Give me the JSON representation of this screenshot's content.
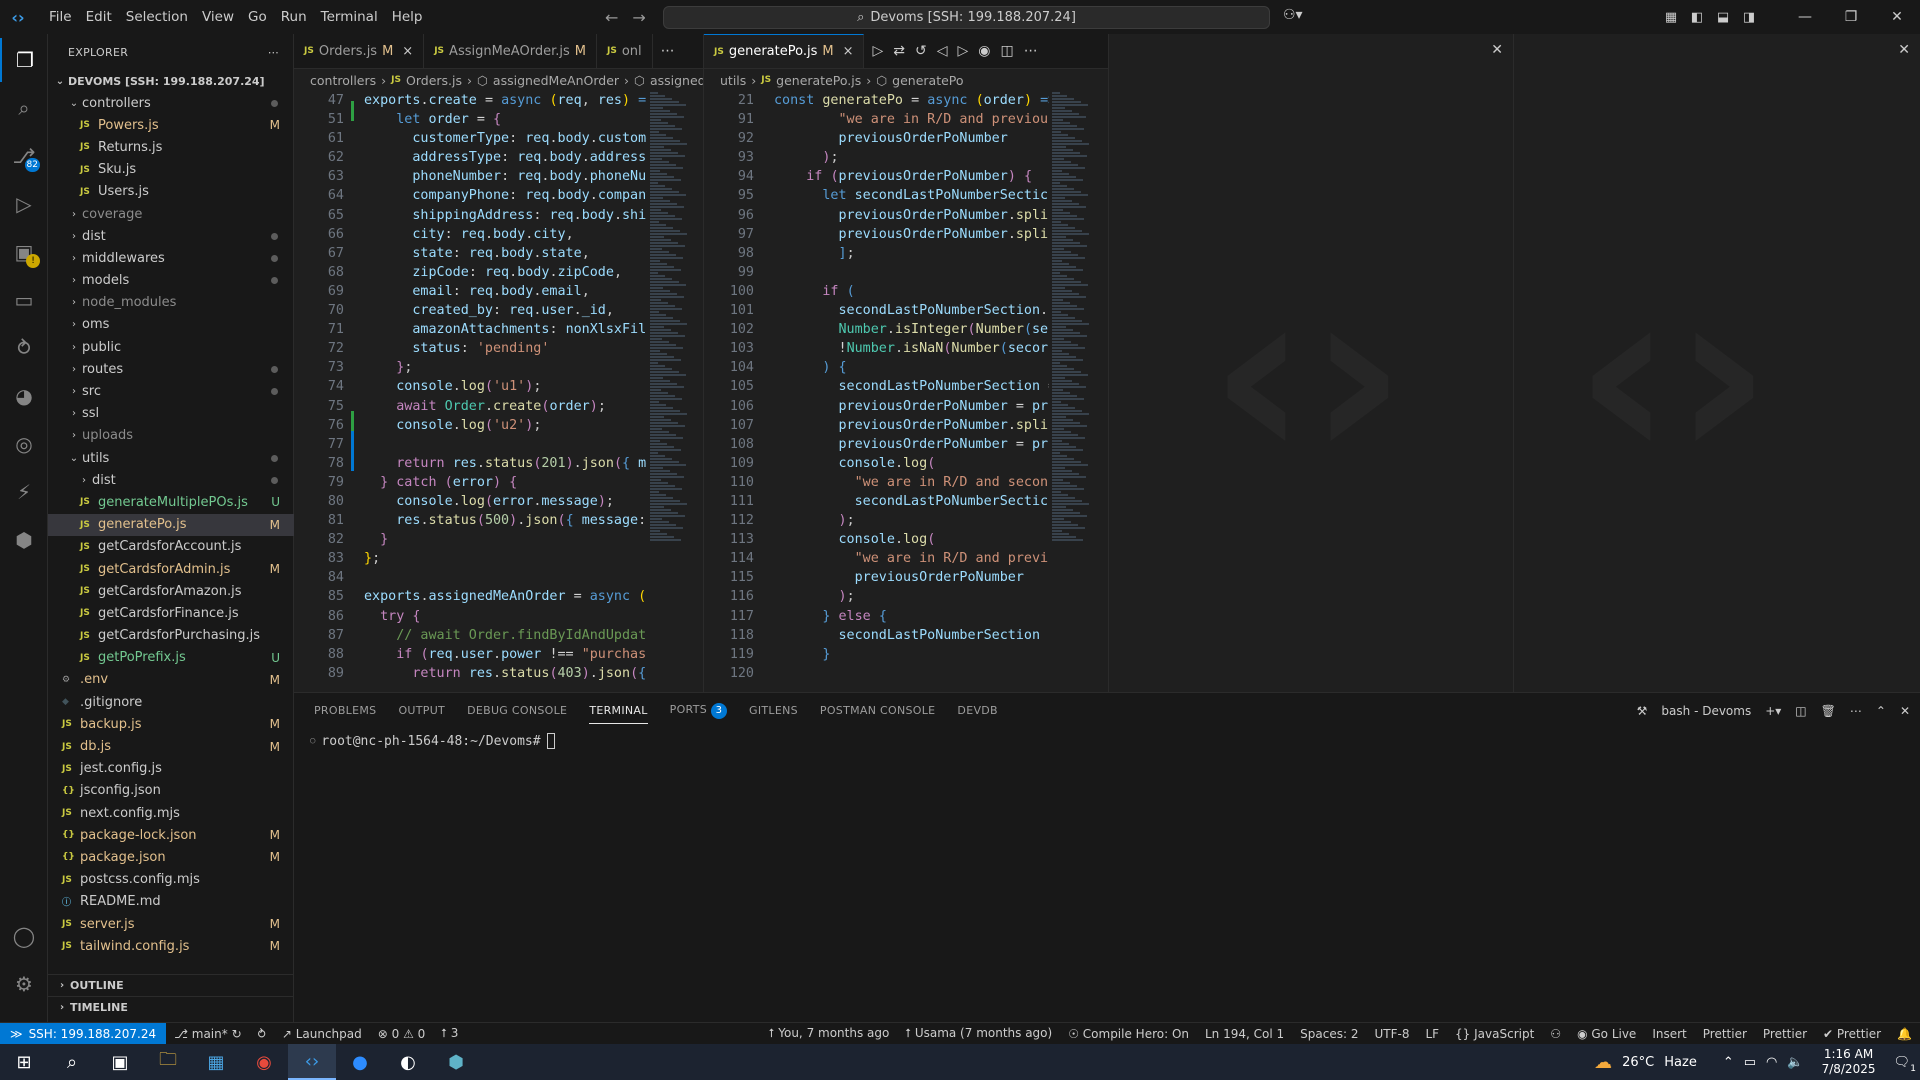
{
  "titlebar": {
    "menu": [
      "File",
      "Edit",
      "Selection",
      "View",
      "Go",
      "Run",
      "Terminal",
      "Help"
    ],
    "command_center": "Devoms [SSH: 199.188.207.24]"
  },
  "explorer": {
    "title": "EXPLORER",
    "root": "DEVOMS [SSH: 199.188.207.24]",
    "rows": [
      {
        "name": "controllers",
        "type": "folder-open",
        "indent": 1,
        "badge": "dot"
      },
      {
        "name": "Powers.js",
        "type": "js",
        "indent": 2,
        "badge": "M",
        "status": "mod"
      },
      {
        "name": "Returns.js",
        "type": "js",
        "indent": 2,
        "badge": "",
        "status": ""
      },
      {
        "name": "Sku.js",
        "type": "js",
        "indent": 2,
        "badge": "",
        "status": ""
      },
      {
        "name": "Users.js",
        "type": "js",
        "indent": 2,
        "badge": "",
        "status": ""
      },
      {
        "name": "coverage",
        "type": "folder",
        "indent": 1,
        "badge": "",
        "status": "dim"
      },
      {
        "name": "dist",
        "type": "folder",
        "indent": 1,
        "badge": "dot",
        "status": ""
      },
      {
        "name": "middlewares",
        "type": "folder",
        "indent": 1,
        "badge": "dot",
        "status": ""
      },
      {
        "name": "models",
        "type": "folder",
        "indent": 1,
        "badge": "dot",
        "status": ""
      },
      {
        "name": "node_modules",
        "type": "folder",
        "indent": 1,
        "badge": "",
        "status": "dim"
      },
      {
        "name": "oms",
        "type": "folder",
        "indent": 1,
        "badge": "",
        "status": ""
      },
      {
        "name": "public",
        "type": "folder",
        "indent": 1,
        "badge": "",
        "status": ""
      },
      {
        "name": "routes",
        "type": "folder",
        "indent": 1,
        "badge": "dot",
        "status": ""
      },
      {
        "name": "src",
        "type": "folder",
        "indent": 1,
        "badge": "dot",
        "status": ""
      },
      {
        "name": "ssl",
        "type": "folder",
        "indent": 1,
        "badge": "",
        "status": ""
      },
      {
        "name": "uploads",
        "type": "folder",
        "indent": 1,
        "badge": "",
        "status": "dim"
      },
      {
        "name": "utils",
        "type": "folder-open",
        "indent": 1,
        "badge": "dot",
        "status": ""
      },
      {
        "name": "dist",
        "type": "folder",
        "indent": 2,
        "badge": "dot",
        "status": ""
      },
      {
        "name": "generateMultiplePOs.js",
        "type": "js",
        "indent": 2,
        "badge": "U",
        "status": "new"
      },
      {
        "name": "generatePo.js",
        "type": "js",
        "indent": 2,
        "badge": "M",
        "status": "mod",
        "selected": true
      },
      {
        "name": "getCardsforAccount.js",
        "type": "js",
        "indent": 2,
        "badge": "",
        "status": ""
      },
      {
        "name": "getCardsforAdmin.js",
        "type": "js",
        "indent": 2,
        "badge": "M",
        "status": "mod"
      },
      {
        "name": "getCardsforAmazon.js",
        "type": "js",
        "indent": 2,
        "badge": "",
        "status": ""
      },
      {
        "name": "getCardsforFinance.js",
        "type": "js",
        "indent": 2,
        "badge": "",
        "status": ""
      },
      {
        "name": "getCardsforPurchasing.js",
        "type": "js",
        "indent": 2,
        "badge": "",
        "status": ""
      },
      {
        "name": "getPoPrefix.js",
        "type": "js",
        "indent": 2,
        "badge": "U",
        "status": "new"
      },
      {
        "name": ".env",
        "type": "gear",
        "indent": 0,
        "badge": "M",
        "status": "mod"
      },
      {
        "name": ".gitignore",
        "type": "git",
        "indent": 0,
        "badge": "",
        "status": ""
      },
      {
        "name": "backup.js",
        "type": "js",
        "indent": 0,
        "badge": "M",
        "status": "mod"
      },
      {
        "name": "db.js",
        "type": "js",
        "indent": 0,
        "badge": "M",
        "status": "mod"
      },
      {
        "name": "jest.config.js",
        "type": "js",
        "indent": 0,
        "badge": "",
        "status": ""
      },
      {
        "name": "jsconfig.json",
        "type": "json",
        "indent": 0,
        "badge": "",
        "status": ""
      },
      {
        "name": "next.config.mjs",
        "type": "js",
        "indent": 0,
        "badge": "",
        "status": ""
      },
      {
        "name": "package-lock.json",
        "type": "json",
        "indent": 0,
        "badge": "M",
        "status": "mod"
      },
      {
        "name": "package.json",
        "type": "json",
        "indent": 0,
        "badge": "M",
        "status": "mod"
      },
      {
        "name": "postcss.config.mjs",
        "type": "js",
        "indent": 0,
        "badge": "",
        "status": ""
      },
      {
        "name": "README.md",
        "type": "info",
        "indent": 0,
        "badge": "",
        "status": ""
      },
      {
        "name": "server.js",
        "type": "js",
        "indent": 0,
        "badge": "M",
        "status": "mod"
      },
      {
        "name": "tailwind.config.js",
        "type": "js",
        "indent": 0,
        "badge": "M",
        "status": "mod"
      }
    ],
    "outline": "OUTLINE",
    "timeline": "TIMELINE"
  },
  "editor_left": {
    "tabs": [
      {
        "label": "Orders.js",
        "mod": "M",
        "close": "×"
      },
      {
        "label": "AssignMeAOrder.js",
        "mod": "M",
        "close": ""
      },
      {
        "label": "onl",
        "mod": "",
        "close": ""
      }
    ],
    "breadcrumbs": [
      "controllers",
      "Orders.js",
      "assignedMeAnOrder",
      "assigned"
    ],
    "lines": [
      {
        "n": "47",
        "h": "<span class='v'>exports</span><span class='p'>.</span><span class='v'>create</span> <span class='p'>=</span> <span class='k'>async</span> <span class='y'>(</span><span class='v'>req</span>, <span class='v'>res</span><span class='y'>)</span> <span class='k'>=</span>"
      },
      {
        "n": "51",
        "h": "    <span class='k'>let</span> <span class='v'>order</span> <span class='p'>=</span> <span class='kc'>{</span>"
      },
      {
        "n": "61",
        "h": "      <span class='v'>customerType</span>: <span class='v'>req</span>.<span class='v'>body</span>.<span class='v'>custome</span>"
      },
      {
        "n": "62",
        "h": "      <span class='v'>addressType</span>: <span class='v'>req</span>.<span class='v'>body</span>.<span class='v'>address</span>"
      },
      {
        "n": "63",
        "h": "      <span class='v'>phoneNumber</span>: <span class='v'>req</span>.<span class='v'>body</span>.<span class='v'>phoneNu</span>"
      },
      {
        "n": "64",
        "h": "      <span class='v'>companyPhone</span>: <span class='v'>req</span>.<span class='v'>body</span>.<span class='v'>company</span>"
      },
      {
        "n": "65",
        "h": "      <span class='v'>shippingAddress</span>: <span class='v'>req</span>.<span class='v'>body</span>.<span class='v'>shi</span>"
      },
      {
        "n": "66",
        "h": "      <span class='v'>city</span>: <span class='v'>req</span>.<span class='v'>body</span>.<span class='v'>city</span>,"
      },
      {
        "n": "67",
        "h": "      <span class='v'>state</span>: <span class='v'>req</span>.<span class='v'>body</span>.<span class='v'>state</span>,"
      },
      {
        "n": "68",
        "h": "      <span class='v'>zipCode</span>: <span class='v'>req</span>.<span class='v'>body</span>.<span class='v'>zipCode</span>,"
      },
      {
        "n": "69",
        "h": "      <span class='v'>email</span>: <span class='v'>req</span>.<span class='v'>body</span>.<span class='v'>email</span>,"
      },
      {
        "n": "70",
        "h": "      <span class='v'>created_by</span>: <span class='v'>req</span>.<span class='v'>user</span>.<span class='v'>_id</span>,"
      },
      {
        "n": "71",
        "h": "      <span class='v'>amazonAttachments</span>: <span class='v'>nonXlsxFil</span>"
      },
      {
        "n": "72",
        "h": "      <span class='v'>status</span>: <span class='s'>'pending'</span>"
      },
      {
        "n": "73",
        "h": "    <span class='kc'>}</span>;"
      },
      {
        "n": "74",
        "h": "    <span class='v'>console</span>.<span class='f'>log</span><span class='kc'>(</span><span class='s'>'u1'</span><span class='kc'>)</span>;"
      },
      {
        "n": "75",
        "h": "    <span class='kc'>await</span> <span class='t'>Order</span>.<span class='f'>create</span><span class='kc'>(</span><span class='v'>order</span><span class='kc'>)</span>;"
      },
      {
        "n": "76",
        "h": "    <span class='v'>console</span>.<span class='f'>log</span><span class='kc'>(</span><span class='s'>'u2'</span><span class='kc'>)</span>;"
      },
      {
        "n": "77",
        "h": ""
      },
      {
        "n": "78",
        "h": "    <span class='kc'>return</span> <span class='v'>res</span>.<span class='f'>status</span><span class='kc'>(</span><span class='n'>201</span><span class='kc'>)</span>.<span class='f'>json</span><span class='kc'>(</span><span class='k'>{</span> <span class='v'>me</span>"
      },
      {
        "n": "79",
        "h": "  <span class='kc'>}</span> <span class='kc'>catch</span> <span class='kc'>(</span><span class='v'>error</span><span class='kc'>)</span> <span class='kc'>{</span>"
      },
      {
        "n": "80",
        "h": "    <span class='v'>console</span>.<span class='f'>log</span><span class='kc'>(</span><span class='v'>error</span>.<span class='v'>message</span><span class='kc'>)</span>;"
      },
      {
        "n": "81",
        "h": "    <span class='v'>res</span>.<span class='f'>status</span><span class='kc'>(</span><span class='n'>500</span><span class='kc'>)</span>.<span class='f'>json</span><span class='kc'>(</span><span class='k'>{</span> <span class='v'>message</span>:"
      },
      {
        "n": "82",
        "h": "  <span class='kc'>}</span>"
      },
      {
        "n": "83",
        "h": "<span class='y'>}</span>;"
      },
      {
        "n": "84",
        "h": ""
      },
      {
        "n": "85",
        "h": "<span class='v'>exports</span>.<span class='v'>assignedMeAnOrder</span> <span class='p'>=</span> <span class='k'>async</span> <span class='y'>(</span>"
      },
      {
        "n": "86",
        "h": "  <span class='kc'>try</span> <span class='kc'>{</span>"
      },
      {
        "n": "87",
        "h": "    <span class='c'>// await Order.findByIdAndUpdate</span>"
      },
      {
        "n": "88",
        "h": "    <span class='kc'>if</span> <span class='kc'>(</span><span class='v'>req</span>.<span class='v'>user</span>.<span class='v'>power</span> <span class='p'>!==</span> <span class='s'>\"purchas</span>"
      },
      {
        "n": "89",
        "h": "      <span class='kc'>return</span> <span class='v'>res</span>.<span class='f'>status</span><span class='kc'>(</span><span class='n'>403</span><span class='kc'>)</span>.<span class='f'>json</span><span class='kc'>(</span><span class='k'>{</span>"
      }
    ]
  },
  "editor_right": {
    "tabs": [
      {
        "label": "generatePo.js",
        "mod": "M",
        "close": "×"
      }
    ],
    "breadcrumbs": [
      "utils",
      "generatePo.js",
      "generatePo"
    ],
    "lines": [
      {
        "n": "21",
        "h": "<span class='k'>const</span> <span class='f'>generatePo</span> <span class='p'>=</span> <span class='k'>async</span> <span class='y'>(</span><span class='v'>order</span><span class='y'>)</span> <span class='k'>=></span>"
      },
      {
        "n": "91",
        "h": "        <span class='s'>\"we are in R/D and previous</span>"
      },
      {
        "n": "92",
        "h": "        <span class='v'>previousOrderPoNumber</span>"
      },
      {
        "n": "93",
        "h": "      <span class='kc'>)</span>;"
      },
      {
        "n": "94",
        "h": "    <span class='kc'>if</span> <span class='kc'>(</span><span class='v'>previousOrderPoNumber</span><span class='kc'>)</span> <span class='kc'>{</span>"
      },
      {
        "n": "95",
        "h": "      <span class='k'>let</span> <span class='v'>secondLastPoNumberSectic</span>"
      },
      {
        "n": "96",
        "h": "        <span class='v'>previousOrderPoNumber</span>.<span class='f'>spli</span>"
      },
      {
        "n": "97",
        "h": "        <span class='v'>previousOrderPoNumber</span>.<span class='f'>spli</span>"
      },
      {
        "n": "98",
        "h": "        <span class='k'>]</span>;"
      },
      {
        "n": "99",
        "h": ""
      },
      {
        "n": "100",
        "h": "      <span class='kc'>if</span> <span class='k'>(</span>"
      },
      {
        "n": "101",
        "h": "        <span class='v'>secondLastPoNumberSection</span>."
      },
      {
        "n": "102",
        "h": "        <span class='t'>Number</span>.<span class='f'>isInteger</span><span class='kc'>(</span><span class='f'>Number</span><span class='k'>(</span><span class='v'>se</span>"
      },
      {
        "n": "103",
        "h": "        <span class='p'>!</span><span class='t'>Number</span>.<span class='f'>isNaN</span><span class='kc'>(</span><span class='f'>Number</span><span class='k'>(</span><span class='v'>secor</span>"
      },
      {
        "n": "104",
        "h": "      <span class='k'>)</span> <span class='k'>{</span>"
      },
      {
        "n": "105",
        "h": "        <span class='v'>secondLastPoNumberSection</span> <span class='p'>=</span>"
      },
      {
        "n": "106",
        "h": "        <span class='v'>previousOrderPoNumber</span> <span class='p'>=</span> <span class='v'>pr</span>"
      },
      {
        "n": "107",
        "h": "        <span class='v'>previousOrderPoNumber</span>.<span class='f'>spli</span>"
      },
      {
        "n": "108",
        "h": "        <span class='v'>previousOrderPoNumber</span> <span class='p'>=</span> <span class='v'>pr</span>"
      },
      {
        "n": "109",
        "h": "        <span class='v'>console</span>.<span class='f'>log</span><span class='kc'>(</span>"
      },
      {
        "n": "110",
        "h": "          <span class='s'>\"we are in R/D and secon</span>"
      },
      {
        "n": "111",
        "h": "          <span class='v'>secondLastPoNumberSectic</span>"
      },
      {
        "n": "112",
        "h": "        <span class='kc'>)</span>;"
      },
      {
        "n": "113",
        "h": "        <span class='v'>console</span>.<span class='f'>log</span><span class='kc'>(</span>"
      },
      {
        "n": "114",
        "h": "          <span class='s'>\"we are in R/D and previ</span>"
      },
      {
        "n": "115",
        "h": "          <span class='v'>previousOrderPoNumber</span>"
      },
      {
        "n": "116",
        "h": "        <span class='kc'>)</span>;"
      },
      {
        "n": "117",
        "h": "      <span class='k'>}</span> <span class='kc'>else</span> <span class='k'>{</span>"
      },
      {
        "n": "118",
        "h": "        <span class='v'>secondLastPoNumberSection</span>"
      },
      {
        "n": "119",
        "h": "      <span class='k'>}</span>"
      },
      {
        "n": "120",
        "h": ""
      }
    ]
  },
  "panel": {
    "tabs": [
      "PROBLEMS",
      "OUTPUT",
      "DEBUG CONSOLE",
      "TERMINAL",
      "PORTS",
      "GITLENS",
      "POSTMAN CONSOLE",
      "DEVDB"
    ],
    "active_tab": "TERMINAL",
    "ports_badge": "3",
    "terminal_name": "bash - Devoms",
    "prompt": "root@nc-ph-1564-48:~/Devoms#"
  },
  "statusbar": {
    "remote": "SSH: 199.188.207.24",
    "branch": "main*",
    "launchpad": "Launchpad",
    "errors": "0",
    "warnings": "0",
    "ports": "3",
    "blame": "You, 7 months ago",
    "author": "Usama (7 months ago)",
    "compile_hero": "Compile Hero: On",
    "position": "Ln 194, Col 1",
    "spaces": "Spaces: 2",
    "encoding": "UTF-8",
    "eol": "LF",
    "language": "JavaScript",
    "go_live": "Go Live",
    "insert": "Insert",
    "prettier1": "Prettier",
    "prettier2": "Prettier",
    "prettier3": "Prettier"
  },
  "taskbar": {
    "weather": "26°C",
    "weather_desc": "Haze",
    "time": "1:16 AM",
    "date": "7/8/2025",
    "notif": "1"
  }
}
